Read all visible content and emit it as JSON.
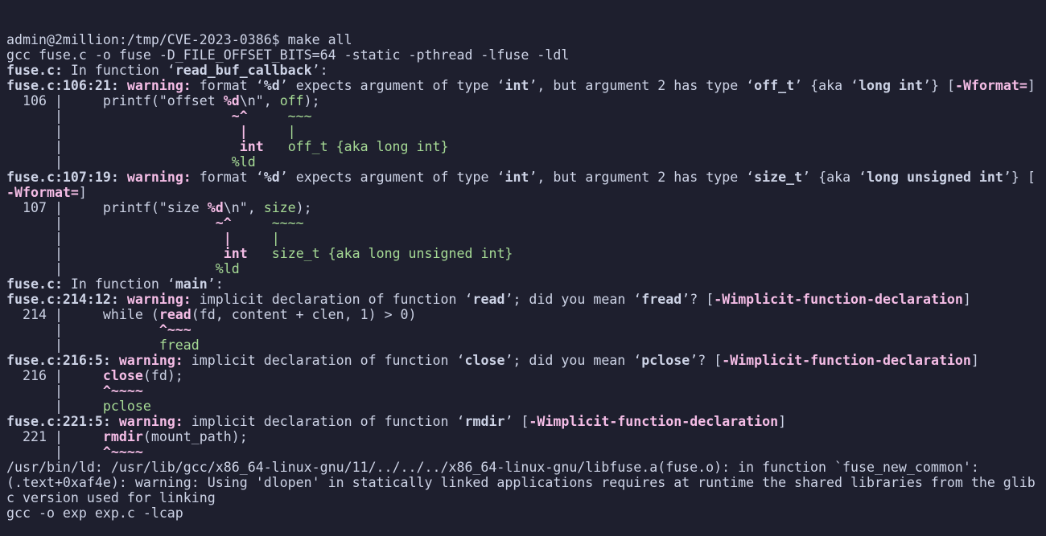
{
  "window": {
    "title": "admin@2million:/tmp/CVE-2023-0386"
  },
  "colors": {
    "background": "#1e1f2e",
    "text": "#cdd3e6",
    "warning": "#f5bde6",
    "fixit": "#a6da95"
  },
  "terminal": {
    "lines": [
      [
        {
          "t": "admin@2million:/tmp/CVE-2023-0386$ make all"
        }
      ],
      [
        {
          "t": "gcc fuse.c -o fuse -D_FILE_OFFSET_BITS=64 -static -pthread -lfuse -ldl"
        }
      ],
      [
        {
          "t": "fuse.c:",
          "c": "b"
        },
        {
          "t": " In function ‘"
        },
        {
          "t": "read_buf_callback",
          "c": "b"
        },
        {
          "t": "’:"
        }
      ],
      [
        {
          "t": "fuse.c:106:21:",
          "c": "b"
        },
        {
          "t": " "
        },
        {
          "t": "warning:",
          "c": "b w"
        },
        {
          "t": " format ‘"
        },
        {
          "t": "%d",
          "c": "b"
        },
        {
          "t": "’ expects argument of type ‘"
        },
        {
          "t": "int",
          "c": "b"
        },
        {
          "t": "’, but argument 2 has type ‘"
        },
        {
          "t": "off_t",
          "c": "b"
        },
        {
          "t": "’ {aka ‘"
        },
        {
          "t": "long int",
          "c": "b"
        },
        {
          "t": "’} ["
        },
        {
          "t": "-Wformat=",
          "c": "b w"
        },
        {
          "t": "]"
        }
      ],
      [
        {
          "t": "  106 |     printf(\"offset "
        },
        {
          "t": "%d",
          "c": "b m"
        },
        {
          "t": "\\n\", "
        },
        {
          "t": "off",
          "c": "g"
        },
        {
          "t": ");"
        }
      ],
      [
        {
          "t": "      |                     "
        },
        {
          "t": "~^",
          "c": "b m"
        },
        {
          "t": "     "
        },
        {
          "t": "~~~",
          "c": "g"
        }
      ],
      [
        {
          "t": "      |                      "
        },
        {
          "t": "|",
          "c": "b m"
        },
        {
          "t": "     "
        },
        {
          "t": "|",
          "c": "g"
        }
      ],
      [
        {
          "t": "      |                      "
        },
        {
          "t": "int",
          "c": "b m"
        },
        {
          "t": "   "
        },
        {
          "t": "off_t {aka long int}",
          "c": "g"
        }
      ],
      [
        {
          "t": "      |                     "
        },
        {
          "t": "%ld",
          "c": "g"
        }
      ],
      [
        {
          "t": "fuse.c:107:19:",
          "c": "b"
        },
        {
          "t": " "
        },
        {
          "t": "warning:",
          "c": "b w"
        },
        {
          "t": " format ‘"
        },
        {
          "t": "%d",
          "c": "b"
        },
        {
          "t": "’ expects argument of type ‘"
        },
        {
          "t": "int",
          "c": "b"
        },
        {
          "t": "’, but argument 2 has type ‘"
        },
        {
          "t": "size_t",
          "c": "b"
        },
        {
          "t": "’ {aka ‘"
        },
        {
          "t": "long unsigned int",
          "c": "b"
        },
        {
          "t": "’} ["
        }
      ],
      [
        {
          "t": "-Wformat=",
          "c": "b w"
        },
        {
          "t": "]"
        }
      ],
      [
        {
          "t": "  107 |     printf(\"size "
        },
        {
          "t": "%d",
          "c": "b m"
        },
        {
          "t": "\\n\", "
        },
        {
          "t": "size",
          "c": "g"
        },
        {
          "t": ");"
        }
      ],
      [
        {
          "t": "      |                   "
        },
        {
          "t": "~^",
          "c": "b m"
        },
        {
          "t": "     "
        },
        {
          "t": "~~~~",
          "c": "g"
        }
      ],
      [
        {
          "t": "      |                    "
        },
        {
          "t": "|",
          "c": "b m"
        },
        {
          "t": "     "
        },
        {
          "t": "|",
          "c": "g"
        }
      ],
      [
        {
          "t": "      |                    "
        },
        {
          "t": "int",
          "c": "b m"
        },
        {
          "t": "   "
        },
        {
          "t": "size_t {aka long unsigned int}",
          "c": "g"
        }
      ],
      [
        {
          "t": "      |                   "
        },
        {
          "t": "%ld",
          "c": "g"
        }
      ],
      [
        {
          "t": "fuse.c:",
          "c": "b"
        },
        {
          "t": " In function ‘"
        },
        {
          "t": "main",
          "c": "b"
        },
        {
          "t": "’:"
        }
      ],
      [
        {
          "t": "fuse.c:214:12:",
          "c": "b"
        },
        {
          "t": " "
        },
        {
          "t": "warning:",
          "c": "b w"
        },
        {
          "t": " implicit declaration of function ‘"
        },
        {
          "t": "read",
          "c": "b"
        },
        {
          "t": "’; did you mean ‘"
        },
        {
          "t": "fread",
          "c": "b"
        },
        {
          "t": "’? ["
        },
        {
          "t": "-Wimplicit-function-declaration",
          "c": "b w"
        },
        {
          "t": "]"
        }
      ],
      [
        {
          "t": "  214 |     while ("
        },
        {
          "t": "read",
          "c": "b m"
        },
        {
          "t": "(fd, content + clen, 1) > 0)"
        }
      ],
      [
        {
          "t": "      |            "
        },
        {
          "t": "^~~~",
          "c": "b m"
        }
      ],
      [
        {
          "t": "      |            "
        },
        {
          "t": "fread",
          "c": "g"
        }
      ],
      [
        {
          "t": "fuse.c:216:5:",
          "c": "b"
        },
        {
          "t": " "
        },
        {
          "t": "warning:",
          "c": "b w"
        },
        {
          "t": " implicit declaration of function ‘"
        },
        {
          "t": "close",
          "c": "b"
        },
        {
          "t": "’; did you mean ‘"
        },
        {
          "t": "pclose",
          "c": "b"
        },
        {
          "t": "’? ["
        },
        {
          "t": "-Wimplicit-function-declaration",
          "c": "b w"
        },
        {
          "t": "]"
        }
      ],
      [
        {
          "t": "  216 |     "
        },
        {
          "t": "close",
          "c": "b m"
        },
        {
          "t": "(fd);"
        }
      ],
      [
        {
          "t": "      |     "
        },
        {
          "t": "^~~~~",
          "c": "b m"
        }
      ],
      [
        {
          "t": "      |     "
        },
        {
          "t": "pclose",
          "c": "g"
        }
      ],
      [
        {
          "t": "fuse.c:221:5:",
          "c": "b"
        },
        {
          "t": " "
        },
        {
          "t": "warning:",
          "c": "b w"
        },
        {
          "t": " implicit declaration of function ‘"
        },
        {
          "t": "rmdir",
          "c": "b"
        },
        {
          "t": "’ ["
        },
        {
          "t": "-Wimplicit-function-declaration",
          "c": "b w"
        },
        {
          "t": "]"
        }
      ],
      [
        {
          "t": "  221 |     "
        },
        {
          "t": "rmdir",
          "c": "b m"
        },
        {
          "t": "(mount_path);"
        }
      ],
      [
        {
          "t": "      |     "
        },
        {
          "t": "^~~~~",
          "c": "b m"
        }
      ],
      [
        {
          "t": "/usr/bin/ld: /usr/lib/gcc/x86_64-linux-gnu/11/../../../x86_64-linux-gnu/libfuse.a(fuse.o): in function `fuse_new_common':"
        }
      ],
      [
        {
          "t": "(.text+0xaf4e): warning: Using 'dlopen' in statically linked applications requires at runtime the shared libraries from the glib"
        }
      ],
      [
        {
          "t": "c version used for linking"
        }
      ],
      [
        {
          "t": "gcc -o exp exp.c -lcap"
        }
      ]
    ]
  }
}
